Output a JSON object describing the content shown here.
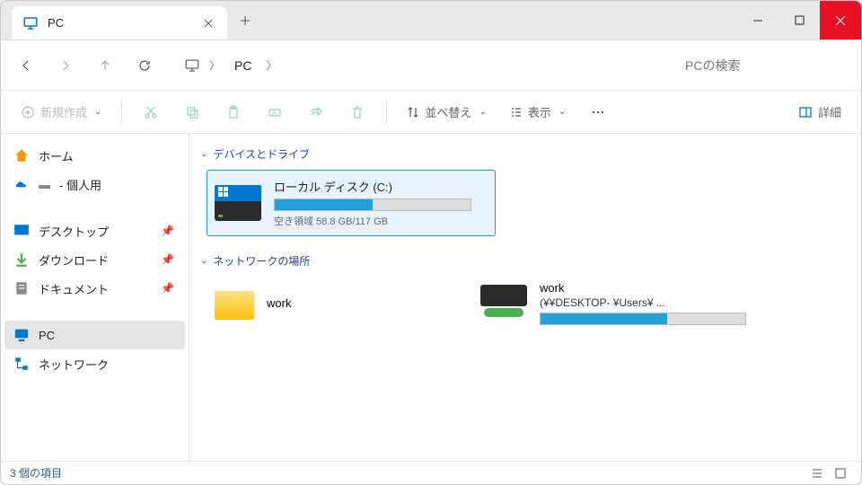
{
  "titlebar": {
    "tab_title": "PC"
  },
  "address": {
    "location": "PC"
  },
  "search": {
    "placeholder": "PCの検索"
  },
  "toolbar": {
    "new_label": "新規作成",
    "sort_label": "並べ替え",
    "view_label": "表示",
    "details_label": "詳細"
  },
  "sidebar": {
    "home": "ホーム",
    "personal_suffix": " - 個人用",
    "desktop": "デスクトップ",
    "downloads": "ダウンロード",
    "documents": "ドキュメント",
    "pc": "PC",
    "network": "ネットワーク"
  },
  "sections": {
    "devices": "デバイスとドライブ",
    "network": "ネットワークの場所"
  },
  "drives": {
    "local": {
      "name": "ローカル ディスク (C:)",
      "sub": "空き領域 58.8 GB/117 GB",
      "fill_percent": 50
    }
  },
  "network_items": {
    "folder": {
      "name": "work"
    },
    "share": {
      "name": "work",
      "path": "(¥¥DESKTOP-          ¥Users¥     ...",
      "fill_percent": 62
    }
  },
  "status": {
    "count": "3 個の項目"
  }
}
